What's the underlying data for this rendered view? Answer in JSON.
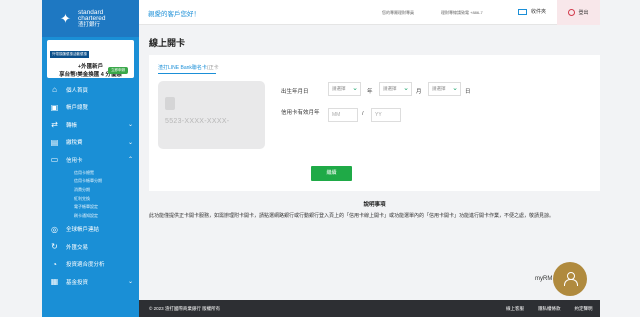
{
  "brand": {
    "line1": "standard",
    "line2": "chartered",
    "line3": "渣打銀行"
  },
  "promo": {
    "tag": "外幣換匯優惠活動優惠",
    "line1": "+外匯新戶",
    "line2": "享台幣/美金換匯 4 分優惠",
    "cta": "立即申辦"
  },
  "nav": {
    "home": "個人首頁",
    "accounts": "帳戶總覽",
    "transfer": "轉帳",
    "payments": "繳稅費",
    "credit_card": "信用卡",
    "credit_sub": [
      "信用卡總覽",
      "信用卡帳單分期",
      "消費分期",
      "紅利兌換",
      "電子帳單設定",
      "刷卡通知設定"
    ],
    "global": "全球帳戶連結",
    "fx": "外匯交易",
    "risk": "投資適合度分析",
    "funds": "基金投資"
  },
  "topbar": {
    "greeting": "親愛的客戶您好！",
    "last_login": "您的專屬理財專員",
    "hotline": "理財專線請致電 +886-7",
    "inbox": "收件夾",
    "logout": "登出"
  },
  "page": {
    "title": "線上開卡",
    "tab_label": "渣打LINE Bank聯名卡",
    "tab_suffix": "(正卡",
    "card_number": "5523-XXXX-XXXX-",
    "birth_label": "出生年月日",
    "select_placeholder": "請選擇",
    "year_unit": "年",
    "month_unit": "月",
    "day_unit": "日",
    "expiry_label": "信用卡有效月年",
    "mm_placeholder": "MM",
    "yy_placeholder": "YY",
    "slash": "/",
    "submit": "繼續",
    "notes_title": "說明事項",
    "notes_text": "此功能僅提供正卡開卡服務，如需辦理附卡開卡，請點選網路銀行或行動銀行登入頁上的「信用卡線上開卡」或功能選單內的「信用卡開卡」功能進行開卡作業，不便之處，敬請見諒。"
  },
  "rm": {
    "label": "myRM"
  },
  "footer": {
    "copyright": "© 2023 渣打國際商業銀行 版權所有",
    "links": [
      "線上客服",
      "隱私權條款",
      "約定聲明"
    ]
  },
  "colors": {
    "sidebar": "#1a8fd6",
    "accent_blue": "#1b8fd7",
    "submit_green": "#1faa47",
    "rm_gold": "#b08a3e",
    "footer": "#2d2f33"
  }
}
